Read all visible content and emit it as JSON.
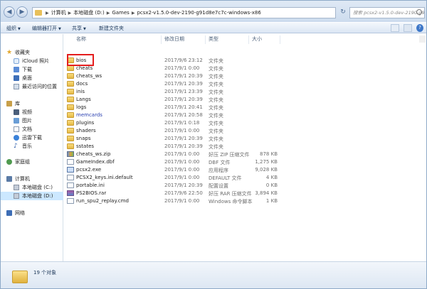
{
  "address": {
    "crumbs": [
      "计算机",
      "本地磁盘 (D:)",
      "Games",
      "pcsx2-v1.5.0-dev-2190-g91d8e7c7c-windows-x86"
    ],
    "search_placeholder": "搜索 pcsx2-v1.5.0-dev-2190-g91d8..."
  },
  "toolbar": {
    "organize": "组织",
    "edit": "编辑器打开",
    "share": "共享",
    "new_folder": "新建文件夹"
  },
  "nav": {
    "favorites": "收藏夹",
    "icloud": "iCloud 照片",
    "downloads": "下载",
    "desktop": "桌面",
    "recent": "最近访问的位置",
    "library": "库",
    "videos": "视频",
    "pictures": "图片",
    "documents": "文档",
    "xunlei": "迅雷下载",
    "music": "音乐",
    "homegroup": "家庭组",
    "computer": "计算机",
    "drive_c": "本地磁盘 (C:)",
    "drive_d": "本地磁盘 (D:)",
    "network": "网络"
  },
  "columns": {
    "name": "名称",
    "date": "修改日期",
    "type": "类型",
    "size": "大小"
  },
  "files": [
    {
      "name": "bios",
      "date": "2017/9/6 23:12",
      "type": "文件夹",
      "size": "",
      "kind": "folder"
    },
    {
      "name": "cheats",
      "date": "2017/9/1 0:00",
      "type": "文件夹",
      "size": "",
      "kind": "folder"
    },
    {
      "name": "cheats_ws",
      "date": "2017/9/1 20:39",
      "type": "文件夹",
      "size": "",
      "kind": "folder"
    },
    {
      "name": "docs",
      "date": "2017/9/1 20:39",
      "type": "文件夹",
      "size": "",
      "kind": "folder"
    },
    {
      "name": "inis",
      "date": "2017/9/1 23:39",
      "type": "文件夹",
      "size": "",
      "kind": "folder"
    },
    {
      "name": "Langs",
      "date": "2017/9/1 20:39",
      "type": "文件夹",
      "size": "",
      "kind": "folder"
    },
    {
      "name": "logs",
      "date": "2017/9/1 20:41",
      "type": "文件夹",
      "size": "",
      "kind": "folder"
    },
    {
      "name": "memcards",
      "date": "2017/9/1 20:58",
      "type": "文件夹",
      "size": "",
      "kind": "folder"
    },
    {
      "name": "plugins",
      "date": "2017/9/1 0:18",
      "type": "文件夹",
      "size": "",
      "kind": "folder"
    },
    {
      "name": "shaders",
      "date": "2017/9/1 0:00",
      "type": "文件夹",
      "size": "",
      "kind": "folder"
    },
    {
      "name": "snaps",
      "date": "2017/9/1 20:39",
      "type": "文件夹",
      "size": "",
      "kind": "folder"
    },
    {
      "name": "sstates",
      "date": "2017/9/1 20:39",
      "type": "文件夹",
      "size": "",
      "kind": "folder"
    },
    {
      "name": "cheats_ws.zip",
      "date": "2017/9/1 0:00",
      "type": "好压 ZIP 压缩文件",
      "size": "878 KB",
      "kind": "zip"
    },
    {
      "name": "GameIndex.dbf",
      "date": "2017/9/1 0:00",
      "type": "DBF 文件",
      "size": "1,275 KB",
      "kind": "file"
    },
    {
      "name": "pcsx2.exe",
      "date": "2017/9/1 0:00",
      "type": "应用程序",
      "size": "9,028 KB",
      "kind": "exe"
    },
    {
      "name": "PCSX2_keys.ini.default",
      "date": "2017/9/1 0:00",
      "type": "DEFAULT 文件",
      "size": "4 KB",
      "kind": "file"
    },
    {
      "name": "portable.ini",
      "date": "2017/9/1 20:39",
      "type": "配置设置",
      "size": "0 KB",
      "kind": "file"
    },
    {
      "name": "PS2BIOS.rar",
      "date": "2017/9/6 22:50",
      "type": "好压 RAR 压缩文件",
      "size": "3,894 KB",
      "kind": "rar"
    },
    {
      "name": "run_spu2_replay.cmd",
      "date": "2017/9/1 0:00",
      "type": "Windows 命令脚本",
      "size": "1 KB",
      "kind": "file"
    }
  ],
  "status": {
    "count": "19 个对象"
  },
  "colors": {
    "highlight": "#e41d1d",
    "selected": "#cce8ff",
    "memcards_text": "#2a3fb0"
  }
}
